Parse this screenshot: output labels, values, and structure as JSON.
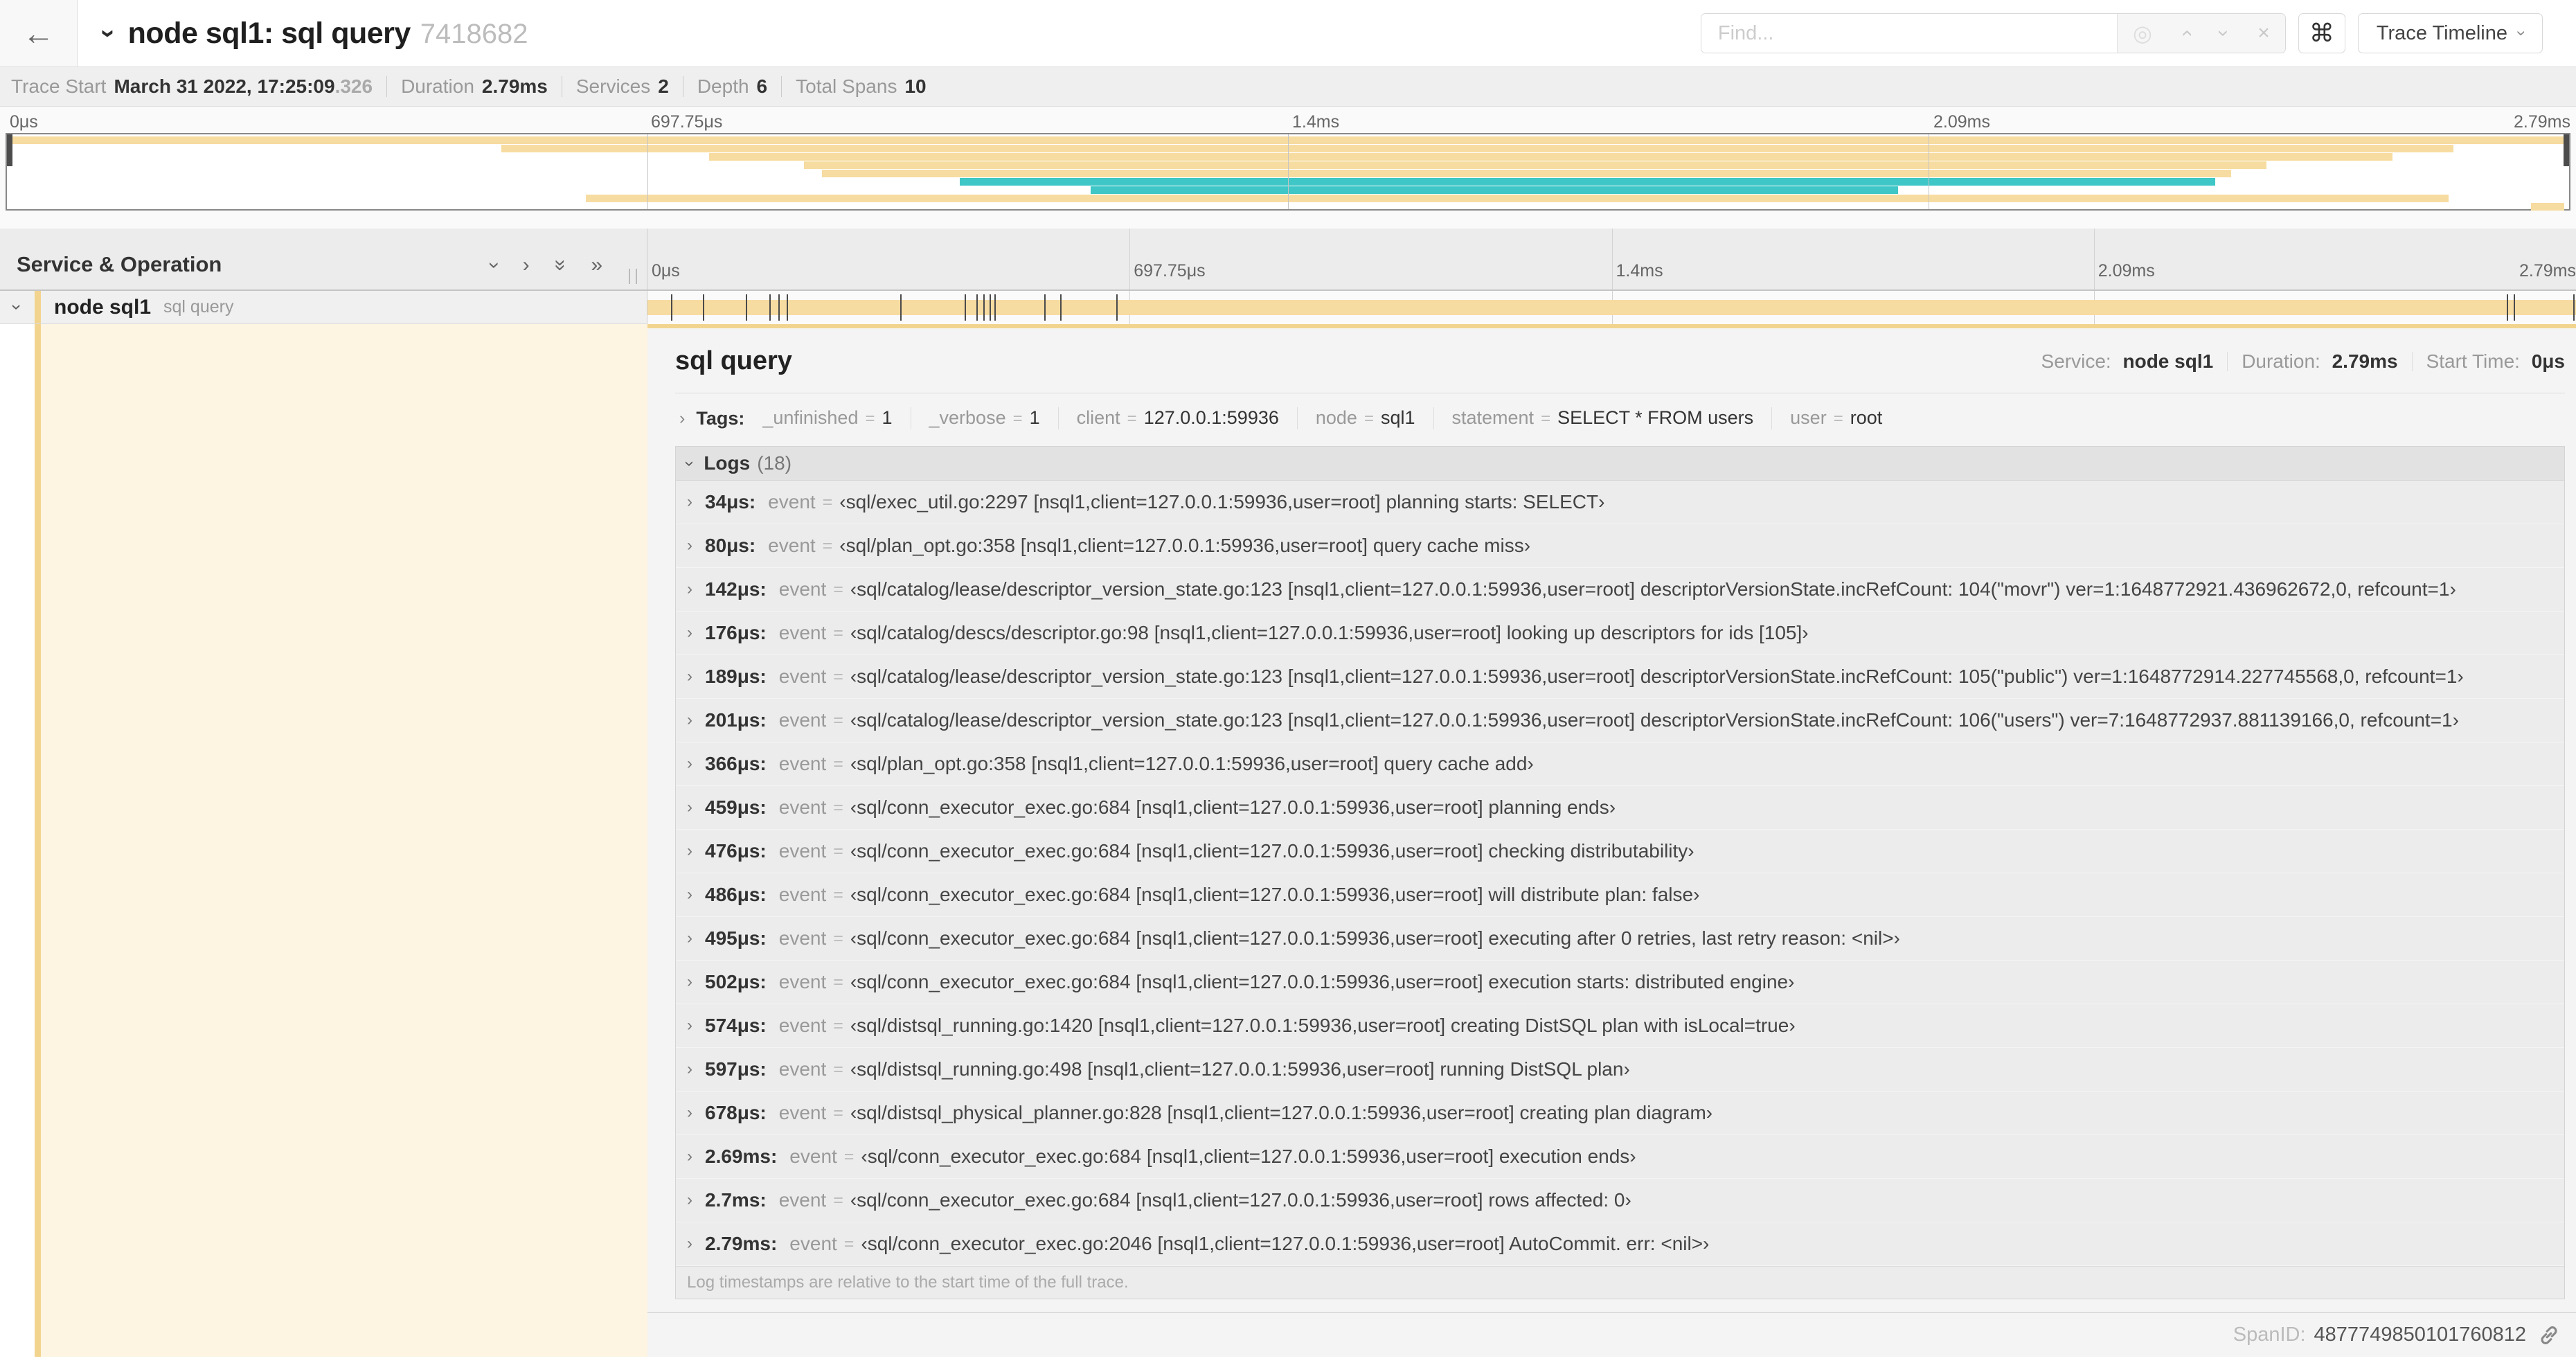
{
  "icons": {
    "back": "←",
    "chevron": "›",
    "double_chevron": "»",
    "close": "×",
    "target": "◎",
    "command": "⌘"
  },
  "header": {
    "title": "node sql1: sql query",
    "trace_id": "7418682",
    "find_placeholder": "Find...",
    "view_selector_label": "Trace Timeline"
  },
  "meta": {
    "items": [
      {
        "label": "Trace Start",
        "value": "March 31 2022, 17:25:09",
        "suffix": ".326"
      },
      {
        "label": "Duration",
        "value": "2.79ms",
        "suffix": ""
      },
      {
        "label": "Services",
        "value": "2",
        "suffix": ""
      },
      {
        "label": "Depth",
        "value": "6",
        "suffix": ""
      },
      {
        "label": "Total Spans",
        "value": "10",
        "suffix": ""
      }
    ]
  },
  "ruler_labels": [
    "0μs",
    "697.75μs",
    "1.4ms",
    "2.09ms",
    "2.79ms"
  ],
  "minimap": {
    "colors": {
      "tan": "#f7dca1",
      "teal": "#3fc6c6"
    },
    "spans": [
      {
        "row": 0,
        "start": 0,
        "end": 100,
        "color": "tan"
      },
      {
        "row": 1,
        "start": 19.3,
        "end": 95.5,
        "color": "tan"
      },
      {
        "row": 2,
        "start": 27.4,
        "end": 93.1,
        "color": "tan"
      },
      {
        "row": 3,
        "start": 31.1,
        "end": 88.2,
        "color": "tan"
      },
      {
        "row": 4,
        "start": 31.8,
        "end": 86.8,
        "color": "tan"
      },
      {
        "row": 5,
        "start": 37.2,
        "end": 86.2,
        "color": "teal"
      },
      {
        "row": 6,
        "start": 42.3,
        "end": 73.8,
        "color": "teal"
      },
      {
        "row": 7,
        "start": 22.6,
        "end": 95.3,
        "color": "tan"
      },
      {
        "row": 8,
        "start": 98.5,
        "end": 99.8,
        "color": "tan"
      }
    ]
  },
  "tree": {
    "header": "Service & Operation",
    "service": "node sql1",
    "operation": "sql query"
  },
  "span_bar": {
    "ticks_pct": [
      1.22,
      2.87,
      5.09,
      6.31,
      6.77,
      7.2,
      13.12,
      16.45,
      17.06,
      17.42,
      17.74,
      17.99,
      20.57,
      21.4,
      24.3,
      96.42,
      96.77,
      99.85
    ]
  },
  "detail": {
    "title": "sql query",
    "service_label": "Service:",
    "service": "node sql1",
    "duration_label": "Duration:",
    "duration": "2.79ms",
    "start_label": "Start Time:",
    "start": "0μs",
    "tags_label": "Tags:",
    "tags": [
      {
        "key": "_unfinished",
        "value": "1"
      },
      {
        "key": "_verbose",
        "value": "1"
      },
      {
        "key": "client",
        "value": "127.0.0.1:59936"
      },
      {
        "key": "node",
        "value": "sql1"
      },
      {
        "key": "statement",
        "value": "SELECT * FROM users"
      },
      {
        "key": "user",
        "value": "root"
      }
    ],
    "logs_label": "Logs",
    "logs_count": "(18)",
    "log_key": "event",
    "logs": [
      {
        "time": "34μs:",
        "value": "‹sql/exec_util.go:2297 [nsql1,client=127.0.0.1:59936,user=root] planning starts: SELECT›"
      },
      {
        "time": "80μs:",
        "value": "‹sql/plan_opt.go:358 [nsql1,client=127.0.0.1:59936,user=root] query cache miss›"
      },
      {
        "time": "142μs:",
        "value": "‹sql/catalog/lease/descriptor_version_state.go:123 [nsql1,client=127.0.0.1:59936,user=root] descriptorVersionState.incRefCount: 104(\"movr\") ver=1:1648772921.436962672,0, refcount=1›"
      },
      {
        "time": "176μs:",
        "value": "‹sql/catalog/descs/descriptor.go:98 [nsql1,client=127.0.0.1:59936,user=root] looking up descriptors for ids [105]›"
      },
      {
        "time": "189μs:",
        "value": "‹sql/catalog/lease/descriptor_version_state.go:123 [nsql1,client=127.0.0.1:59936,user=root] descriptorVersionState.incRefCount: 105(\"public\") ver=1:1648772914.227745568,0, refcount=1›"
      },
      {
        "time": "201μs:",
        "value": "‹sql/catalog/lease/descriptor_version_state.go:123 [nsql1,client=127.0.0.1:59936,user=root] descriptorVersionState.incRefCount: 106(\"users\") ver=7:1648772937.881139166,0, refcount=1›"
      },
      {
        "time": "366μs:",
        "value": "‹sql/plan_opt.go:358 [nsql1,client=127.0.0.1:59936,user=root] query cache add›"
      },
      {
        "time": "459μs:",
        "value": "‹sql/conn_executor_exec.go:684 [nsql1,client=127.0.0.1:59936,user=root] planning ends›"
      },
      {
        "time": "476μs:",
        "value": "‹sql/conn_executor_exec.go:684 [nsql1,client=127.0.0.1:59936,user=root] checking distributability›"
      },
      {
        "time": "486μs:",
        "value": "‹sql/conn_executor_exec.go:684 [nsql1,client=127.0.0.1:59936,user=root] will distribute plan: false›"
      },
      {
        "time": "495μs:",
        "value": "‹sql/conn_executor_exec.go:684 [nsql1,client=127.0.0.1:59936,user=root] executing after 0 retries, last retry reason: <nil>›"
      },
      {
        "time": "502μs:",
        "value": "‹sql/conn_executor_exec.go:684 [nsql1,client=127.0.0.1:59936,user=root] execution starts: distributed engine›"
      },
      {
        "time": "574μs:",
        "value": "‹sql/distsql_running.go:1420 [nsql1,client=127.0.0.1:59936,user=root] creating DistSQL plan with isLocal=true›"
      },
      {
        "time": "597μs:",
        "value": "‹sql/distsql_running.go:498 [nsql1,client=127.0.0.1:59936,user=root] running DistSQL plan›"
      },
      {
        "time": "678μs:",
        "value": "‹sql/distsql_physical_planner.go:828 [nsql1,client=127.0.0.1:59936,user=root] creating plan diagram›"
      },
      {
        "time": "2.69ms:",
        "value": "‹sql/conn_executor_exec.go:684 [nsql1,client=127.0.0.1:59936,user=root] execution ends›"
      },
      {
        "time": "2.7ms:",
        "value": "‹sql/conn_executor_exec.go:684 [nsql1,client=127.0.0.1:59936,user=root] rows affected: 0›"
      },
      {
        "time": "2.79ms:",
        "value": "‹sql/conn_executor_exec.go:2046 [nsql1,client=127.0.0.1:59936,user=root] AutoCommit. err: <nil>›"
      }
    ],
    "footer_note": "Log timestamps are relative to the start time of the full trace.",
    "spanid_label": "SpanID:",
    "spanid": "4877749850101760812"
  }
}
